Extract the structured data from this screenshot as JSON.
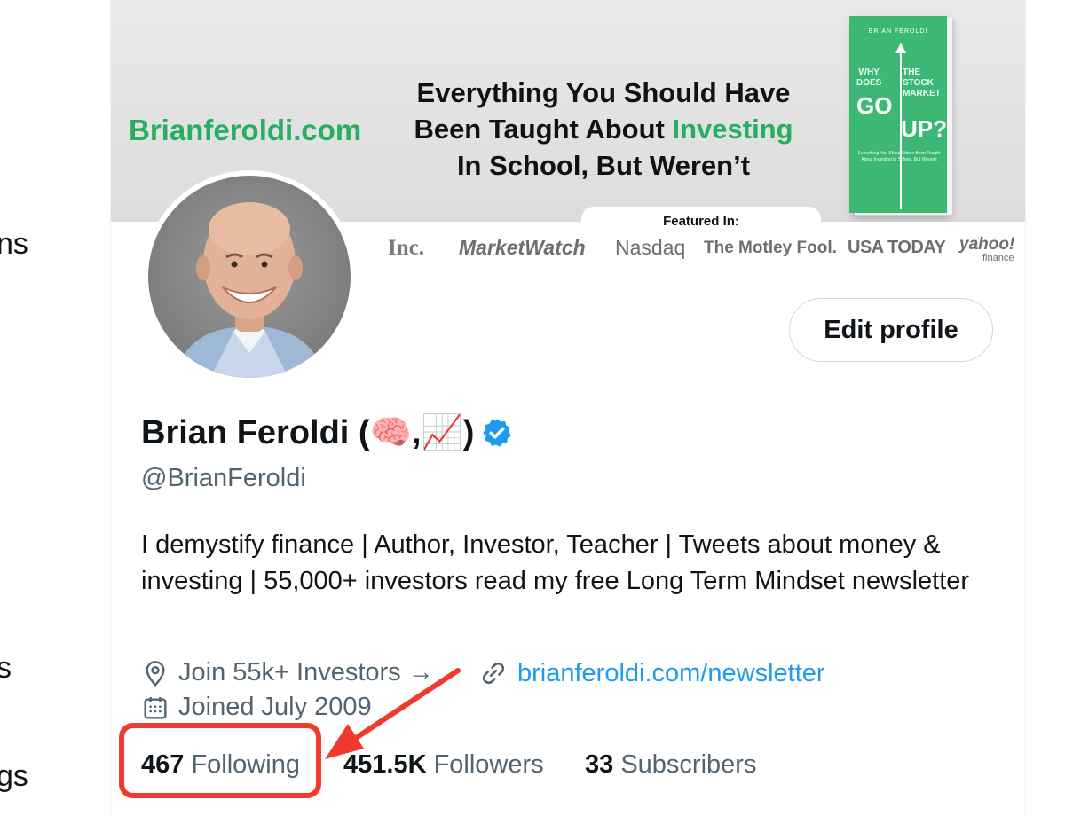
{
  "sidebar_fragments": [
    "ns",
    "s",
    "gs"
  ],
  "banner": {
    "site": "Brianferoldi.com",
    "headline_line1": "Everything You Should Have",
    "headline_line2_pre": "Been Taught About ",
    "headline_line2_green": "Investing",
    "headline_line3": "In School, But Weren’t",
    "featured_label": "Featured In:",
    "logos": [
      "Inc.",
      "MarketWatch",
      "Nasdaq",
      "The Motley Fool.",
      "USA TODAY",
      "yahoo!",
      "finance"
    ],
    "book": {
      "author": "BRIAN FEROLDI",
      "why": "WHY",
      "does": "DOES",
      "the": "THE",
      "stock": "STOCK",
      "market": "MARKET",
      "go": "GO",
      "up": "UP?",
      "subtitle": "Everything You Should Have Been Taught About Investing In School, But Weren't"
    }
  },
  "profile": {
    "edit_button": "Edit profile",
    "display_name": "Brian Feroldi (🧠,📈)",
    "handle": "@BrianFeroldi",
    "bio": "I demystify finance | Author, Investor, Teacher | Tweets about money & investing | 55,000+ investors read my free Long Term Mindset newsletter",
    "location": "Join 55k+ Investors →",
    "website": "brianferoldi.com/newsletter",
    "joined": "Joined July 2009"
  },
  "stats": {
    "following_count": "467",
    "following_label": "Following",
    "followers_count": "451.5K",
    "followers_label": "Followers",
    "subscribers_count": "33",
    "subscribers_label": "Subscribers"
  },
  "colors": {
    "brand_green": "#27ae60",
    "link_blue": "#1d9bf0",
    "annotation_red": "#f2392d",
    "muted_text": "#536471"
  }
}
